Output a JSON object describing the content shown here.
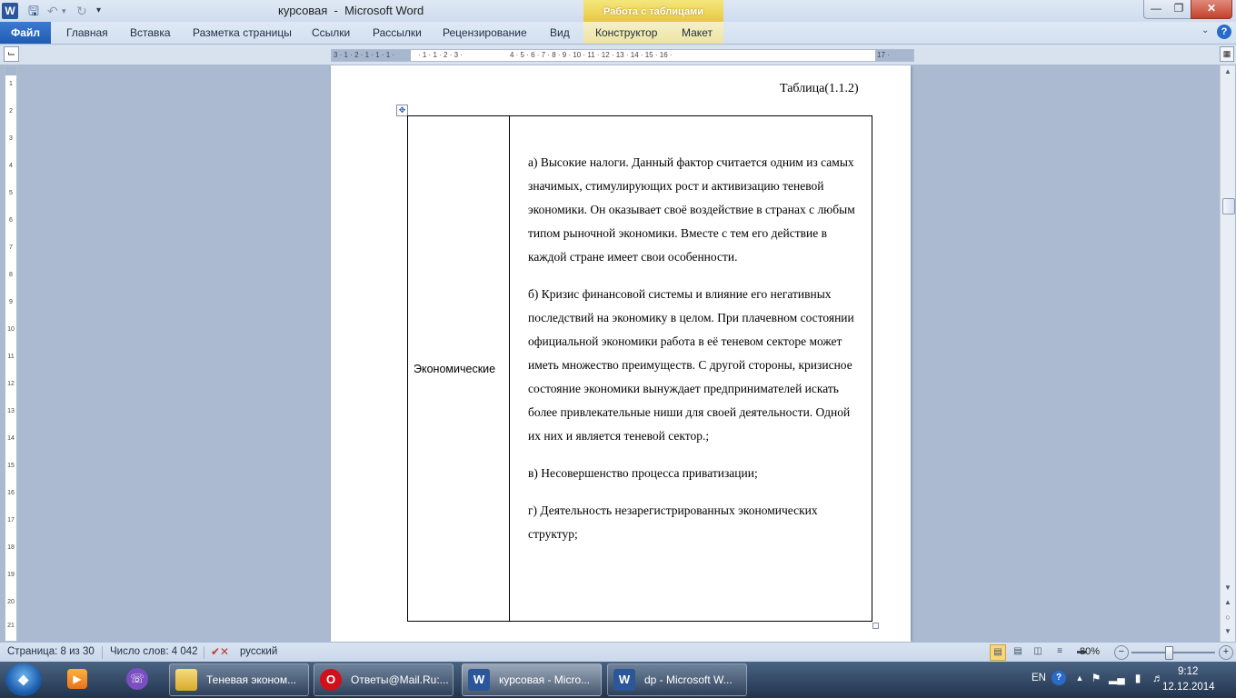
{
  "window": {
    "title": "курсовая  -  Microsoft Word",
    "contextual_group": "Работа с таблицами",
    "app_icon": "W"
  },
  "icons": {
    "save": "save-icon",
    "undo": "undo-icon",
    "redo": "redo-icon",
    "minimize": "minimize-icon",
    "maximize": "maximize-icon",
    "close": "close-icon"
  },
  "ribbon": {
    "tabs": {
      "file": "Файл",
      "home": "Главная",
      "insert": "Вставка",
      "layout": "Разметка страницы",
      "references": "Ссылки",
      "mailings": "Рассылки",
      "review": "Рецензирование",
      "view": "Вид",
      "design": "Конструктор",
      "table_layout": "Макет"
    },
    "help": "?"
  },
  "document": {
    "caption": "Таблица(1.1.2)",
    "table": {
      "left_cell": "Экономические",
      "paragraphs": [
        "а) Высокие налоги.  Данный фактор считается одним из самых значимых, стимулирующих рост и активизацию теневой экономики. Он оказывает своё воздействие в странах с любым типом рыночной экономики. Вместе с тем его действие в каждой стране имеет свои особенности.",
        "б) Кризис финансовой системы и влияние его негативных последствий на экономику в целом.  При плачевном состоянии официальной экономики работа в её теневом секторе может иметь множество преимуществ. С другой стороны, кризисное состояние экономики вынуждает предпринимателей искать более привлекательные ниши для своей деятельности. Одной их них и является теневой сектор.;",
        "в) Несовершенство процесса приватизации;",
        "г) Деятельность незарегистрированных экономических структур;"
      ]
    }
  },
  "statusbar": {
    "page": "Страница: 8 из 30",
    "words": "Число слов: 4 042",
    "language": "русский",
    "zoom": "80%",
    "zoom_level": 0.45
  },
  "taskbar": {
    "tasks": {
      "folder": "Теневая эконом...",
      "opera": "Ответы@Mail.Ru:...",
      "word1": "курсовая - Micro...",
      "word2": "dp - Microsoft W..."
    },
    "tray": {
      "language": "EN",
      "time": "9:12",
      "date": "12.12.2014"
    }
  },
  "colors": {
    "word_blue": "#2b579a",
    "file_tab": "#2a67bf",
    "contextual_gold": "#e8c842",
    "close_red": "#c3412c",
    "workspace": "#abbad0"
  }
}
